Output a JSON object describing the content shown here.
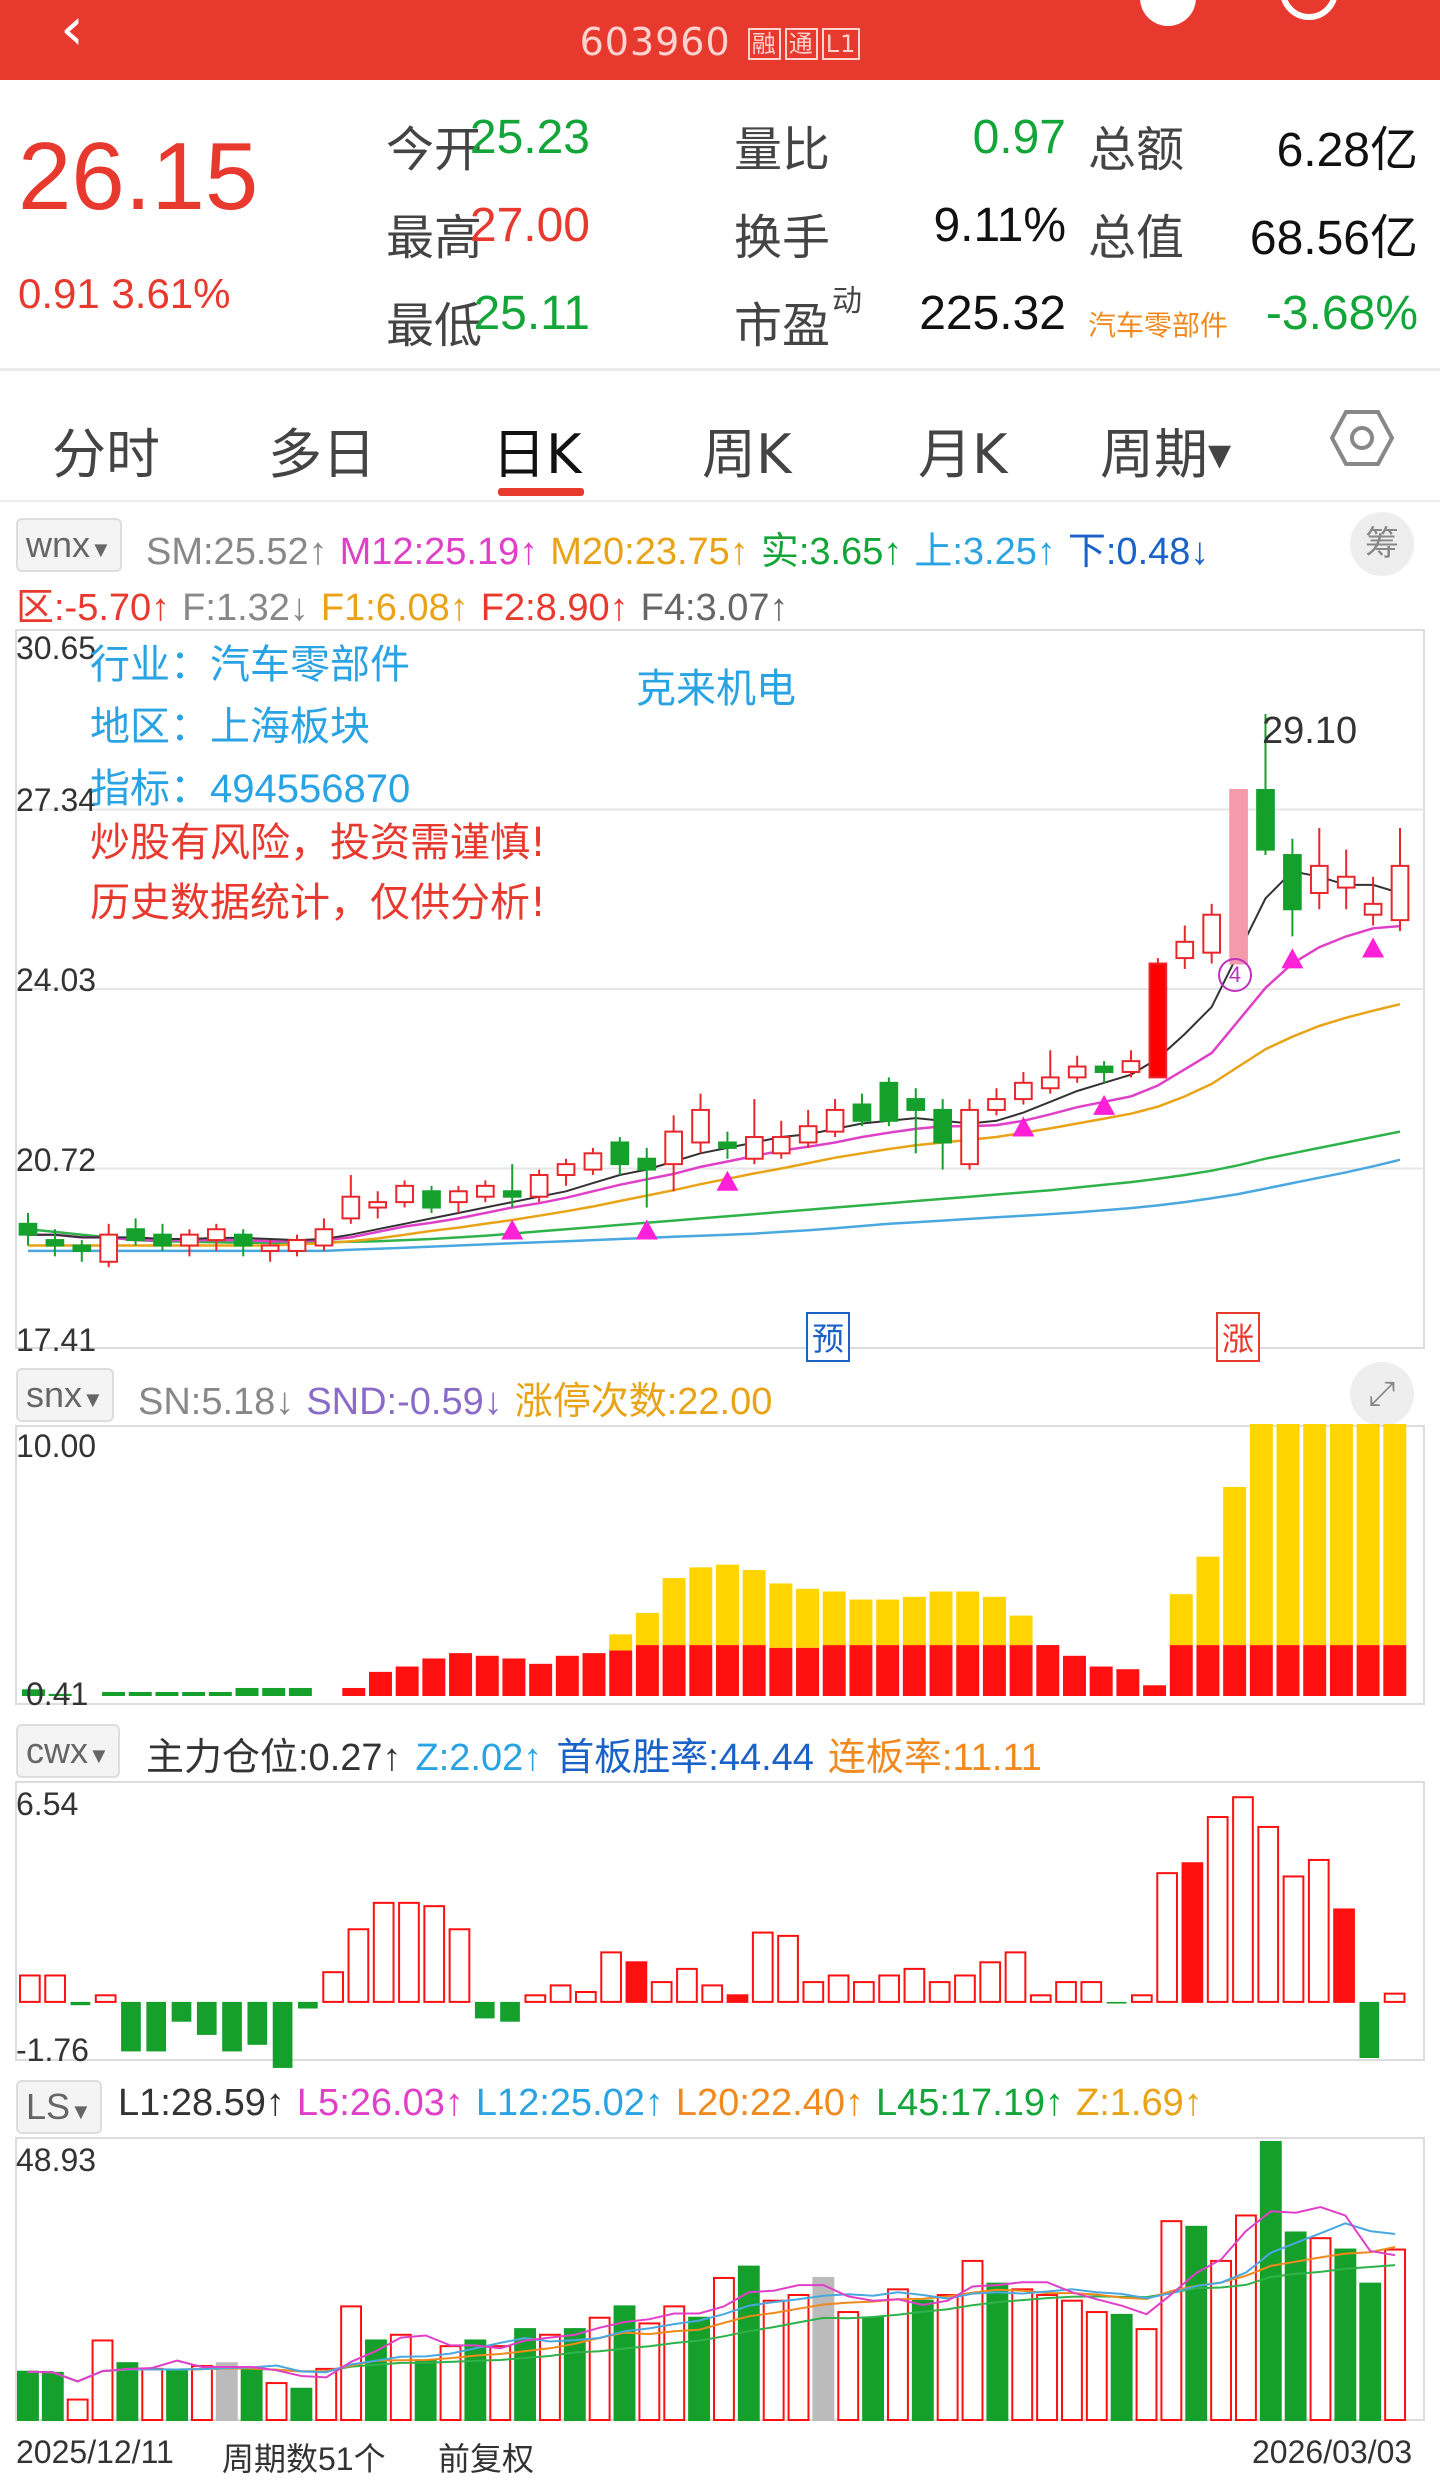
{
  "header": {
    "code": "603960",
    "tags": [
      "融",
      "通",
      "L1"
    ]
  },
  "quote": {
    "price": "26.15",
    "change": "0.91",
    "change_pct": "3.61%",
    "rows": [
      [
        {
          "l": "今开",
          "v": "25.23",
          "c": "g"
        },
        {
          "l": "量比",
          "v": "0.97",
          "c": "g"
        },
        {
          "l": "总额",
          "v": "6.28亿",
          "c": "k"
        }
      ],
      [
        {
          "l": "最高",
          "v": "27.00",
          "c": "r"
        },
        {
          "l": "换手",
          "v": "9.11%",
          "c": "k"
        },
        {
          "l": "总值",
          "v": "68.56亿",
          "c": "k"
        }
      ],
      [
        {
          "l": "最低",
          "v": "25.11",
          "c": "g"
        },
        {
          "l": "市盈",
          "sup": "动",
          "v": "225.32",
          "c": "k"
        },
        {
          "l": "汽车零部件",
          "v": "-3.68%",
          "c": "g"
        }
      ]
    ]
  },
  "tabs": [
    "分时",
    "多日",
    "日K",
    "周K",
    "月K",
    "周期"
  ],
  "settings_icon": "hexagon-settings-icon",
  "main": {
    "indicator": "wnx",
    "line1": [
      {
        "t": "SM:25.52↑",
        "c": "#888"
      },
      {
        "t": "M12:25.19↑",
        "c": "#e040c8"
      },
      {
        "t": "M20:23.75↑",
        "c": "#e8a317"
      },
      {
        "t": "实:3.65↑",
        "c": "#13a538"
      },
      {
        "t": "上:3.25↑",
        "c": "#29a3e3"
      },
      {
        "t": "下:0.48↓",
        "c": "#1a62c7"
      }
    ],
    "line2": [
      {
        "t": "区:-5.70↑",
        "c": "#e8392f"
      },
      {
        "t": "F:1.32↓",
        "c": "#888"
      },
      {
        "t": "F1:6.08↑",
        "c": "#e8a317"
      },
      {
        "t": "F2:8.90↑",
        "c": "#e8392f"
      },
      {
        "t": "F4:3.07↑",
        "c": "#666"
      }
    ],
    "chip": "筹",
    "y_ticks": [
      "30.65",
      "27.34",
      "24.03",
      "20.72",
      "17.41"
    ],
    "info": {
      "hy": "行业：汽车零部件",
      "dq": "地区：上海板块",
      "zb": "指标：494556870",
      "name": "克来机电",
      "warn1": "炒股有风险，投资需谨慎!",
      "warn2": "历史数据统计，仅供分析!"
    },
    "peak_label": "29.10",
    "circle_label": "4",
    "mark_yu": "预",
    "mark_zhang": "涨"
  },
  "snx": {
    "indicator": "snx",
    "items": [
      {
        "t": "SN:5.18↓",
        "c": "#888"
      },
      {
        "t": "SND:-0.59↓",
        "c": "#8a6cc8"
      },
      {
        "t": "涨停次数:22.00",
        "c": "#e8a317"
      }
    ],
    "y_top": "10.00",
    "y_bot": "0.41"
  },
  "cwx": {
    "indicator": "cwx",
    "items": [
      {
        "t": "主力仓位:0.27↑",
        "c": "#333"
      },
      {
        "t": "Z:2.02↑",
        "c": "#29a3e3"
      },
      {
        "t": "首板胜率:44.44",
        "c": "#1a62c7"
      },
      {
        "t": "连板率:11.11",
        "c": "#f08a1e"
      }
    ],
    "y_top": "6.54",
    "y_bot": "-1.76"
  },
  "ls": {
    "indicator": "LS",
    "items": [
      {
        "t": "L1:28.59↑",
        "c": "#333"
      },
      {
        "t": "L5:26.03↑",
        "c": "#e040c8"
      },
      {
        "t": "L12:25.02↑",
        "c": "#29a3e3"
      },
      {
        "t": "L20:22.40↑",
        "c": "#f08a1e"
      },
      {
        "t": "L45:17.19↑",
        "c": "#13a538"
      },
      {
        "t": "Z:1.69↑",
        "c": "#e8a317"
      }
    ],
    "y_top": "48.93"
  },
  "footer": {
    "start": "2025/12/11",
    "period": "周期数51个",
    "adjust": "前复权",
    "end": "2026/03/03"
  },
  "chart_data": {
    "type": "candlestick",
    "ylim": [
      17.41,
      30.65
    ],
    "candles": [
      [
        19.7,
        19.5,
        19.9,
        19.3
      ],
      [
        19.4,
        19.3,
        19.6,
        19.1
      ],
      [
        19.3,
        19.2,
        19.4,
        19.0
      ],
      [
        19.0,
        19.5,
        19.7,
        18.9
      ],
      [
        19.6,
        19.4,
        19.8,
        19.3
      ],
      [
        19.5,
        19.3,
        19.7,
        19.2
      ],
      [
        19.3,
        19.5,
        19.6,
        19.1
      ],
      [
        19.4,
        19.6,
        19.7,
        19.2
      ],
      [
        19.5,
        19.3,
        19.6,
        19.1
      ],
      [
        19.2,
        19.3,
        19.4,
        19.0
      ],
      [
        19.2,
        19.4,
        19.5,
        19.1
      ],
      [
        19.3,
        19.6,
        19.8,
        19.2
      ],
      [
        19.8,
        20.2,
        20.6,
        19.7
      ],
      [
        20.0,
        20.1,
        20.3,
        19.8
      ],
      [
        20.1,
        20.4,
        20.5,
        20.0
      ],
      [
        20.3,
        20.0,
        20.4,
        19.9
      ],
      [
        20.1,
        20.3,
        20.4,
        19.9
      ],
      [
        20.2,
        20.4,
        20.5,
        20.1
      ],
      [
        20.3,
        20.2,
        20.8,
        20.0
      ],
      [
        20.2,
        20.6,
        20.7,
        20.1
      ],
      [
        20.6,
        20.8,
        20.9,
        20.4
      ],
      [
        20.7,
        21.0,
        21.1,
        20.6
      ],
      [
        21.2,
        20.8,
        21.3,
        20.6
      ],
      [
        20.9,
        20.7,
        21.1,
        20.0
      ],
      [
        20.8,
        21.4,
        21.7,
        20.3
      ],
      [
        21.2,
        21.8,
        22.1,
        21.0
      ],
      [
        21.2,
        21.1,
        21.4,
        20.9
      ],
      [
        20.9,
        21.3,
        22.0,
        20.8
      ],
      [
        21.0,
        21.3,
        21.6,
        20.9
      ],
      [
        21.2,
        21.5,
        21.8,
        21.1
      ],
      [
        21.4,
        21.8,
        22.0,
        21.3
      ],
      [
        21.9,
        21.6,
        22.1,
        21.5
      ],
      [
        22.3,
        21.6,
        22.4,
        21.5
      ],
      [
        22.0,
        21.8,
        22.2,
        21.0
      ],
      [
        21.8,
        21.2,
        22.0,
        20.7
      ],
      [
        20.8,
        21.8,
        22.0,
        20.7
      ],
      [
        21.8,
        22.0,
        22.2,
        21.7
      ],
      [
        22.0,
        22.3,
        22.5,
        21.9
      ],
      [
        22.2,
        22.4,
        22.9,
        22.1
      ],
      [
        22.4,
        22.6,
        22.8,
        22.3
      ],
      [
        22.6,
        22.5,
        22.7,
        22.3
      ],
      [
        22.5,
        22.7,
        22.9,
        22.4
      ],
      [
        22.4,
        24.5,
        24.6,
        22.4
      ],
      [
        24.6,
        24.9,
        25.2,
        24.4
      ],
      [
        24.7,
        25.4,
        25.6,
        24.5
      ],
      [
        24.5,
        27.7,
        27.7,
        24.5
      ],
      [
        27.7,
        26.6,
        29.1,
        26.5
      ],
      [
        26.5,
        25.5,
        26.8,
        25.0
      ],
      [
        25.8,
        26.3,
        27.0,
        25.5
      ],
      [
        25.9,
        26.1,
        26.6,
        25.5
      ],
      [
        25.4,
        25.6,
        26.1,
        25.2
      ],
      [
        25.3,
        26.3,
        27.0,
        25.1
      ]
    ],
    "ma_sm": [
      19.5,
      19.5,
      19.45,
      19.45,
      19.45,
      19.42,
      19.42,
      19.44,
      19.44,
      19.42,
      19.4,
      19.42,
      19.5,
      19.6,
      19.7,
      19.8,
      19.9,
      20.0,
      20.1,
      20.2,
      20.3,
      20.45,
      20.6,
      20.7,
      20.85,
      21.0,
      21.1,
      21.2,
      21.3,
      21.35,
      21.45,
      21.55,
      21.6,
      21.65,
      21.6,
      21.55,
      21.6,
      21.75,
      21.95,
      22.15,
      22.3,
      22.45,
      22.75,
      23.2,
      23.7,
      24.7,
      25.7,
      26.2,
      26.1,
      25.95,
      25.95,
      25.8
    ],
    "ma_m12": [
      19.5,
      19.5,
      19.45,
      19.45,
      19.4,
      19.4,
      19.4,
      19.4,
      19.4,
      19.38,
      19.38,
      19.4,
      19.45,
      19.55,
      19.65,
      19.72,
      19.8,
      19.9,
      20.0,
      20.08,
      20.18,
      20.3,
      20.42,
      20.52,
      20.62,
      20.75,
      20.85,
      20.95,
      21.05,
      21.12,
      21.2,
      21.3,
      21.38,
      21.45,
      21.5,
      21.5,
      21.52,
      21.6,
      21.72,
      21.85,
      21.95,
      22.05,
      22.25,
      22.55,
      22.85,
      23.45,
      24.05,
      24.5,
      24.8,
      25.0,
      25.15,
      25.19
    ],
    "ma_m20": [
      19.3,
      19.3,
      19.3,
      19.3,
      19.3,
      19.3,
      19.3,
      19.3,
      19.3,
      19.3,
      19.32,
      19.34,
      19.38,
      19.43,
      19.5,
      19.57,
      19.63,
      19.7,
      19.77,
      19.85,
      19.93,
      20.02,
      20.12,
      20.22,
      20.32,
      20.43,
      20.53,
      20.63,
      20.72,
      20.82,
      20.92,
      21.0,
      21.08,
      21.15,
      21.2,
      21.25,
      21.3,
      21.38,
      21.46,
      21.55,
      21.64,
      21.73,
      21.86,
      22.05,
      22.28,
      22.6,
      22.92,
      23.15,
      23.35,
      23.5,
      23.63,
      23.75
    ],
    "ma_green": [
      19.6,
      19.55,
      19.5,
      19.45,
      19.4,
      19.38,
      19.37,
      19.36,
      19.35,
      19.35,
      19.35,
      19.36,
      19.37,
      19.38,
      19.4,
      19.42,
      19.45,
      19.48,
      19.52,
      19.56,
      19.6,
      19.64,
      19.68,
      19.72,
      19.76,
      19.8,
      19.84,
      19.88,
      19.92,
      19.96,
      20.0,
      20.04,
      20.08,
      20.12,
      20.16,
      20.2,
      20.24,
      20.28,
      20.32,
      20.37,
      20.42,
      20.47,
      20.53,
      20.6,
      20.68,
      20.78,
      20.9,
      21.0,
      21.1,
      21.2,
      21.3,
      21.4
    ],
    "ma_blue": [
      19.2,
      19.2,
      19.2,
      19.2,
      19.2,
      19.2,
      19.2,
      19.2,
      19.2,
      19.2,
      19.2,
      19.2,
      19.22,
      19.24,
      19.26,
      19.28,
      19.3,
      19.32,
      19.34,
      19.36,
      19.38,
      19.4,
      19.42,
      19.44,
      19.46,
      19.48,
      19.5,
      19.52,
      19.55,
      19.58,
      19.62,
      19.66,
      19.7,
      19.73,
      19.76,
      19.79,
      19.82,
      19.85,
      19.88,
      19.91,
      19.95,
      19.99,
      20.04,
      20.1,
      20.17,
      20.25,
      20.35,
      20.45,
      20.55,
      20.65,
      20.76,
      20.88
    ],
    "arrows": [
      18,
      23,
      26,
      37,
      40,
      47,
      50
    ],
    "snx_red": [
      0,
      0,
      0,
      0,
      0,
      0,
      0,
      0,
      0,
      0,
      0,
      0,
      0.3,
      0.9,
      1.1,
      1.4,
      1.6,
      1.5,
      1.4,
      1.2,
      1.5,
      1.6,
      1.7,
      1.9,
      1.9,
      1.9,
      1.9,
      1.9,
      1.8,
      1.8,
      1.9,
      1.9,
      1.9,
      1.9,
      1.9,
      1.9,
      1.9,
      1.9,
      1.9,
      1.5,
      1.1,
      1.0,
      0.4,
      1.9,
      1.9,
      1.9,
      1.9,
      1.9,
      1.9,
      1.9,
      1.9,
      1.9
    ],
    "snx_yellow": [
      0,
      0,
      0,
      0,
      0,
      0,
      0,
      0,
      0,
      0,
      0,
      0,
      0,
      0,
      0,
      0,
      0,
      0,
      0,
      0,
      0,
      0,
      0.6,
      1.2,
      2.5,
      2.9,
      3.0,
      2.8,
      2.4,
      2.2,
      2.0,
      1.7,
      1.7,
      1.8,
      2.0,
      2.0,
      1.8,
      1.1,
      0,
      0,
      0,
      0,
      0,
      1.9,
      3.3,
      5.9,
      8.8,
      8.9,
      8.8,
      8.8,
      8.8,
      8.6
    ],
    "snx_pink": [
      0,
      0,
      0,
      0,
      0,
      0,
      0,
      0,
      0,
      0,
      0,
      0,
      0,
      0,
      0,
      0,
      0,
      0,
      0,
      0,
      0,
      0,
      0,
      0,
      0,
      0,
      0,
      0,
      0,
      0,
      0,
      0,
      0,
      0,
      0,
      0,
      0,
      0,
      0,
      0,
      0,
      0,
      0,
      0,
      0,
      0,
      2.1,
      3.5,
      3.0,
      2.1,
      1.2,
      0.5
    ],
    "snx_green": [
      0.25,
      0.08,
      0,
      0.15,
      0.15,
      0.15,
      0.15,
      0.15,
      0.3,
      0.3,
      0.3,
      0,
      0,
      0,
      0,
      0,
      0,
      0,
      0,
      0,
      0,
      0,
      0,
      0,
      0,
      0,
      0,
      0,
      0,
      0,
      0,
      0,
      0,
      0,
      0,
      0,
      0,
      0,
      0,
      0,
      0,
      0,
      0,
      0,
      0,
      0,
      0,
      0,
      0,
      0,
      0,
      0
    ],
    "cwx": [
      0.8,
      0.8,
      -0.1,
      0.2,
      -1.5,
      -1.5,
      -0.6,
      -1.0,
      -1.5,
      -1.3,
      -2.0,
      -0.2,
      0.9,
      2.2,
      3.0,
      3.0,
      2.9,
      2.2,
      -0.5,
      -0.6,
      0.2,
      0.5,
      0.3,
      1.5,
      1.2,
      0.6,
      1.0,
      0.5,
      0.2,
      2.1,
      2.0,
      0.6,
      0.8,
      0.6,
      0.8,
      1.0,
      0.6,
      0.8,
      1.2,
      1.5,
      0.2,
      0.6,
      0.6,
      -0.05,
      0.2,
      3.9,
      4.2,
      5.6,
      6.2,
      5.3,
      3.8,
      4.3,
      2.8,
      -1.7,
      0.25
    ],
    "ls_bars": [
      {
        "v": 8.5,
        "c": "g"
      },
      {
        "v": 8.3,
        "c": "g"
      },
      {
        "v": 3.6,
        "c": "r"
      },
      {
        "v": 14.0,
        "c": "r"
      },
      {
        "v": 10.0,
        "c": "g"
      },
      {
        "v": 9.0,
        "c": "r"
      },
      {
        "v": 8.8,
        "c": "g"
      },
      {
        "v": 9.5,
        "c": "r"
      },
      {
        "v": 10.0,
        "c": "x"
      },
      {
        "v": 9.0,
        "c": "g"
      },
      {
        "v": 6.5,
        "c": "r"
      },
      {
        "v": 5.5,
        "c": "g"
      },
      {
        "v": 9.0,
        "c": "r"
      },
      {
        "v": 20.0,
        "c": "r"
      },
      {
        "v": 14.0,
        "c": "g"
      },
      {
        "v": 15.0,
        "c": "r"
      },
      {
        "v": 10.5,
        "c": "g"
      },
      {
        "v": 13.0,
        "c": "r"
      },
      {
        "v": 14.0,
        "c": "g"
      },
      {
        "v": 13.0,
        "c": "r"
      },
      {
        "v": 16.0,
        "c": "g"
      },
      {
        "v": 15.0,
        "c": "r"
      },
      {
        "v": 16.0,
        "c": "g"
      },
      {
        "v": 18.0,
        "c": "r"
      },
      {
        "v": 20.0,
        "c": "g"
      },
      {
        "v": 17.0,
        "c": "r"
      },
      {
        "v": 20.0,
        "c": "r"
      },
      {
        "v": 18.0,
        "c": "g"
      },
      {
        "v": 25.0,
        "c": "r"
      },
      {
        "v": 27.0,
        "c": "g"
      },
      {
        "v": 21.0,
        "c": "r"
      },
      {
        "v": 22.0,
        "c": "r"
      },
      {
        "v": 25.0,
        "c": "x"
      },
      {
        "v": 19.0,
        "c": "r"
      },
      {
        "v": 18.0,
        "c": "g"
      },
      {
        "v": 23.0,
        "c": "r"
      },
      {
        "v": 21.0,
        "c": "g"
      },
      {
        "v": 22.0,
        "c": "r"
      },
      {
        "v": 28.0,
        "c": "r"
      },
      {
        "v": 24.0,
        "c": "g"
      },
      {
        "v": 23.0,
        "c": "r"
      },
      {
        "v": 22.0,
        "c": "r"
      },
      {
        "v": 21.0,
        "c": "r"
      },
      {
        "v": 19.0,
        "c": "r"
      },
      {
        "v": 18.5,
        "c": "g"
      },
      {
        "v": 16.0,
        "c": "r"
      },
      {
        "v": 35.0,
        "c": "r"
      },
      {
        "v": 34.0,
        "c": "g"
      },
      {
        "v": 28.0,
        "c": "r"
      },
      {
        "v": 36.0,
        "c": "r"
      },
      {
        "v": 48.93,
        "c": "g"
      },
      {
        "v": 33.0,
        "c": "g"
      },
      {
        "v": 32.0,
        "c": "r"
      },
      {
        "v": 30.0,
        "c": "g"
      },
      {
        "v": 24.0,
        "c": "g"
      },
      {
        "v": 30.0,
        "c": "r"
      }
    ]
  }
}
